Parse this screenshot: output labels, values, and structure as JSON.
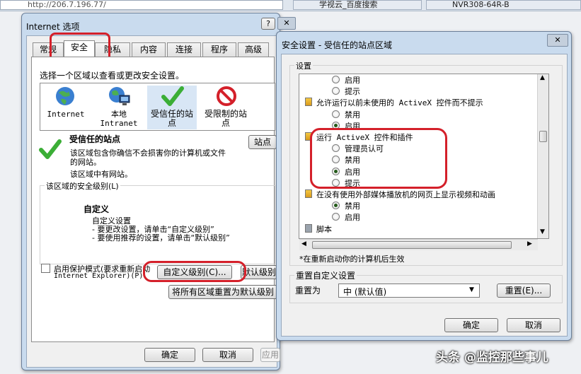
{
  "browser": {
    "address": "http://206.7.196.77/",
    "tabs": [
      "学视云_百度搜索",
      "NVR308-64R-B"
    ]
  },
  "options_dialog": {
    "title": "Internet 选项",
    "help_label": "?",
    "close_label": "✕",
    "tabs": [
      "常规",
      "安全",
      "隐私",
      "内容",
      "连接",
      "程序",
      "高级"
    ],
    "instruction": "选择一个区域以查看或更改安全设置。",
    "zones": [
      {
        "label": "Internet",
        "icon": "globe-icon"
      },
      {
        "label": "本地\nIntranet",
        "icon": "intranet-icon"
      },
      {
        "label": "受信任的站\n点",
        "icon": "check-icon"
      },
      {
        "label": "受限制的站\n点",
        "icon": "restricted-icon"
      }
    ],
    "zone_title": "受信任的站点",
    "zone_desc_line1": "该区域包含你确信不会损害你的计算机或文件",
    "zone_desc_line2": "的网站。",
    "zone_has_sites": "该区域中有网站。",
    "sites_button": "站点",
    "level_group": "该区域的安全级别(L)",
    "custom_title": "自定义",
    "custom_line1": "自定义设置",
    "custom_line2": "- 要更改设置，请单击“自定义级别”",
    "custom_line3": "- 要使用推荐的设置，请单击“默认级别”",
    "protected_mode_line1": "启用保护模式(要求重新启动",
    "protected_mode_line2": "Internet Explorer)(P)",
    "custom_level_button": "自定义级别(C)...",
    "default_level_button": "默认级别",
    "reset_all_button": "将所有区域重置为默认级别",
    "ok_button": "确定",
    "cancel_button": "取消",
    "apply_button": "应用(A)"
  },
  "security_dialog": {
    "title": "安全设置 - 受信任的站点区域",
    "close_label": "✕",
    "settings_group": "设置",
    "items": [
      {
        "type": "radio",
        "label": "启用",
        "checked": false
      },
      {
        "type": "radio",
        "label": "提示",
        "checked": false
      },
      {
        "type": "heading",
        "label": "允许运行以前未使用的 ActiveX 控件而不提示"
      },
      {
        "type": "radio",
        "label": "禁用",
        "checked": false
      },
      {
        "type": "radio",
        "label": "启用",
        "checked": true
      },
      {
        "type": "heading",
        "label": "运行 ActiveX 控件和插件"
      },
      {
        "type": "radio",
        "label": "管理员认可",
        "checked": false
      },
      {
        "type": "radio",
        "label": "禁用",
        "checked": false
      },
      {
        "type": "radio",
        "label": "启用",
        "checked": true
      },
      {
        "type": "radio",
        "label": "提示",
        "checked": false
      },
      {
        "type": "heading",
        "label": "在没有使用外部媒体播放机的网页上显示视频和动画"
      },
      {
        "type": "radio",
        "label": "禁用",
        "checked": true
      },
      {
        "type": "radio",
        "label": "启用",
        "checked": false
      },
      {
        "type": "heading",
        "label": "脚本"
      }
    ],
    "restart_note": "*在重新启动你的计算机后生效",
    "reset_group": "重置自定义设置",
    "reset_to_label": "重置为",
    "reset_select": "中 (默认值)",
    "reset_button": "重置(E)...",
    "ok_button": "确定",
    "cancel_button": "取消"
  },
  "watermark": "头条 @监控那些事儿",
  "colors": {
    "highlight_ring": "#d4202a",
    "title_bar": "#c9dbee"
  }
}
